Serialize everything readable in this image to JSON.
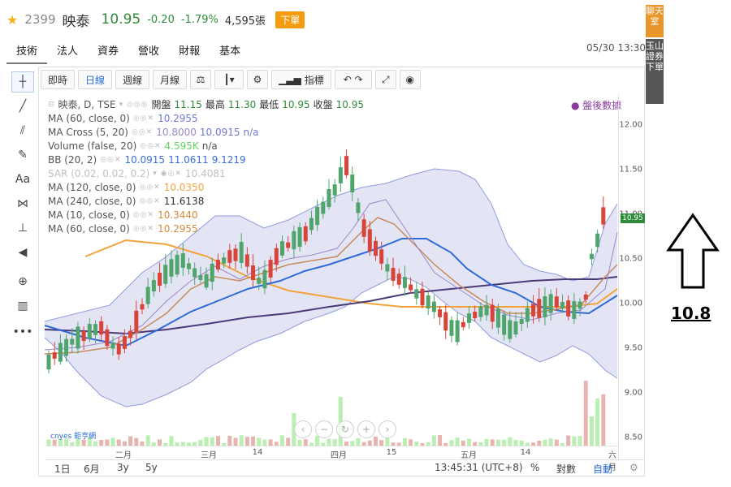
{
  "header": {
    "code": "2399",
    "name": "映泰",
    "price": "10.95",
    "change": "-0.20",
    "change_pct": "-1.79%",
    "volume": "4,595張",
    "order_label": "下單"
  },
  "tabs": [
    "技術",
    "法人",
    "資券",
    "營收",
    "財報",
    "基本"
  ],
  "datetime": "05/30 13:30",
  "side": {
    "chat": "聊天室",
    "broker": "玉山證券下單"
  },
  "toolbar": {
    "intraday": "即時",
    "daily": "日線",
    "weekly": "週線",
    "monthly": "月線",
    "indicators": "指標"
  },
  "legend": {
    "main_label": "映泰, D, TSE",
    "open_label": "開盤",
    "open": "11.15",
    "high_label": "最高",
    "high": "11.30",
    "low_label": "最低",
    "low": "10.95",
    "close_label": "收盤",
    "close": "10.95",
    "after_hours": "● 盤後數據",
    "rows": [
      {
        "label": "MA (60, close, 0)",
        "value": "10.2955",
        "color": "#6f78d6"
      },
      {
        "label": "MA Cross (5, 20)",
        "value": "10.8000",
        "value2": "10.0915",
        "value3": "n/a",
        "color": "#6f78d6"
      },
      {
        "label": "Volume (false, 20)",
        "value": "4.595K",
        "value2": "n/a",
        "color": "#5fd35f"
      },
      {
        "label": "BB (20, 2)",
        "value": "10.0915",
        "value2": "11.0611",
        "value3": "9.1219",
        "color": "#3c6ed8"
      },
      {
        "label": "SAR (0.02, 0.02, 0.2)",
        "value": "10.4081",
        "color": "#c0c0c0"
      },
      {
        "label": "MA (120, close, 0)",
        "value": "10.0350",
        "color": "#f2a33a"
      },
      {
        "label": "MA (240, close, 0)",
        "value": "11.6138",
        "color": "#333333"
      },
      {
        "label": "MA (10, close, 0)",
        "value": "10.3440",
        "color": "#d48a3a"
      },
      {
        "label": "MA (60, close, 0)",
        "value": "10.2955",
        "color": "#d48a3a"
      }
    ]
  },
  "y_ticks": [
    "12.00",
    "11.50",
    "11.00",
    "10.50",
    "10.00",
    "9.50",
    "9.00",
    "8.50"
  ],
  "y_last": "10.95",
  "x_ticks": [
    "二月",
    "三月",
    "14",
    "四月",
    "15",
    "五月",
    "14",
    "六月"
  ],
  "bottom": {
    "ranges": [
      "1日",
      "6月",
      "3y",
      "5y"
    ],
    "time": "13:45:31 (UTC+8)",
    "pct": "%",
    "log": "對數",
    "auto": "自動"
  },
  "cnyes": "cnyes 鉅亨網",
  "annotation_value": "10.8",
  "colors": {
    "up": "#d9443a",
    "down": "#4fa56b",
    "band_fill": "#dfe0f2",
    "band_line": "#8e9be0"
  }
}
